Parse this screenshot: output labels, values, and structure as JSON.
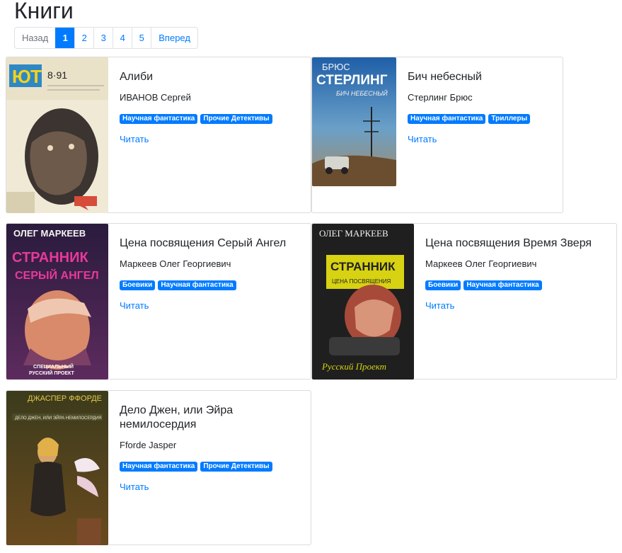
{
  "page_title": "Книги",
  "pagination": {
    "prev": "Назад",
    "pages": [
      "1",
      "2",
      "3",
      "4",
      "5"
    ],
    "active": "1",
    "next": "Вперед"
  },
  "colors": {
    "accent": "#007bff",
    "border": "#dcdcdc"
  },
  "books": [
    {
      "title": "Алиби",
      "author": "ИВАНОВ Сергей",
      "tags": [
        "Научная фантастика",
        "Прочие Детективы"
      ],
      "read": "Читать",
      "cover": {
        "brand": "ЮТ",
        "issue": "8·91"
      }
    },
    {
      "title": "Бич небесный",
      "author": "Стерлинг Брюс",
      "tags": [
        "Научная фантастика",
        "Триллеры"
      ],
      "read": "Читать",
      "cover": {
        "line1": "БРЮС",
        "line2": "СТЕРЛИНГ",
        "line3": "БИЧ НЕБЕСНЫЙ"
      }
    },
    {
      "title": "Цена посвящения Серый Ангел",
      "author": "Маркеев Олег Георгиевич",
      "tags": [
        "Боевики",
        "Научная фантастика"
      ],
      "read": "Читать",
      "cover": {
        "line1": "ОЛЕГ МАРКЕЕВ",
        "line2": "СТРАННИК",
        "line3": "СЕРЫЙ АНГЕЛ",
        "line4": "СПЕЦИАЛЬНЫЙ",
        "line5": "РУССКИЙ ПРОЕКТ"
      }
    },
    {
      "title": "Цена посвящения Время Зверя",
      "author": "Маркеев Олег Георгиевич",
      "tags": [
        "Боевики",
        "Научная фантастика"
      ],
      "read": "Читать",
      "cover": {
        "line1": "ОЛЕГ МАРКЕЕВ",
        "line2": "СТРАННИК",
        "line3": "ЦЕНА ПОСВЯЩЕНИЯ",
        "line4": "Русский Проект"
      }
    },
    {
      "title": "Дело Джен, или Эйра немилосердия",
      "author": "Fforde Jasper",
      "tags": [
        "Научная фантастика",
        "Прочие Детективы"
      ],
      "read": "Читать",
      "cover": {
        "line1": "ДЖАСПЕР ФФОРДЕ",
        "line2": "ДЕЛО ДЖЕН, ИЛИ ЭЙРА НЕМИЛОСЕРДИЯ"
      }
    }
  ]
}
